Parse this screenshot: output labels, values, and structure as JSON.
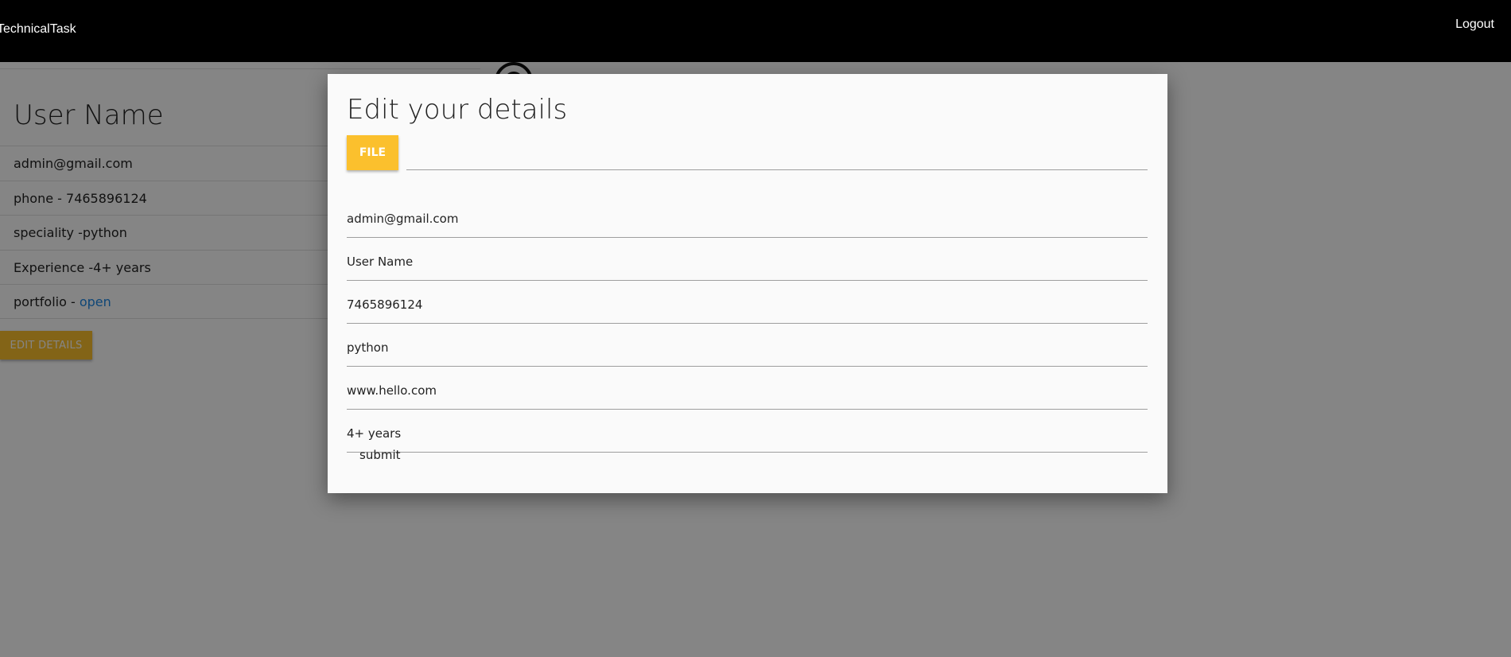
{
  "navbar": {
    "brand": "TechnicalTask",
    "logout_label": "Logout"
  },
  "profile": {
    "name": "User Name",
    "details": [
      {
        "text": "admin@gmail.com"
      },
      {
        "text": "phone - 7465896124"
      },
      {
        "text": "speciality -python"
      },
      {
        "text": "Experience -4+ years"
      },
      {
        "prefix": "portfolio - ",
        "link": "open"
      }
    ],
    "edit_button_label": "EDIT DETAILS"
  },
  "modal": {
    "title": "Edit your details",
    "file_button_label": "FILE",
    "fields": [
      {
        "name": "email",
        "value": "admin@gmail.com"
      },
      {
        "name": "name",
        "value": "User Name"
      },
      {
        "name": "phone",
        "value": "7465896124"
      },
      {
        "name": "speciality",
        "value": "python"
      },
      {
        "name": "portfolio",
        "value": "www.hello.com"
      },
      {
        "name": "experience",
        "value": "4+ years"
      }
    ],
    "submit_label": "submit"
  },
  "colors": {
    "accent": "#fbc02d",
    "navbar": "#000000",
    "link": "#1e88e5"
  }
}
